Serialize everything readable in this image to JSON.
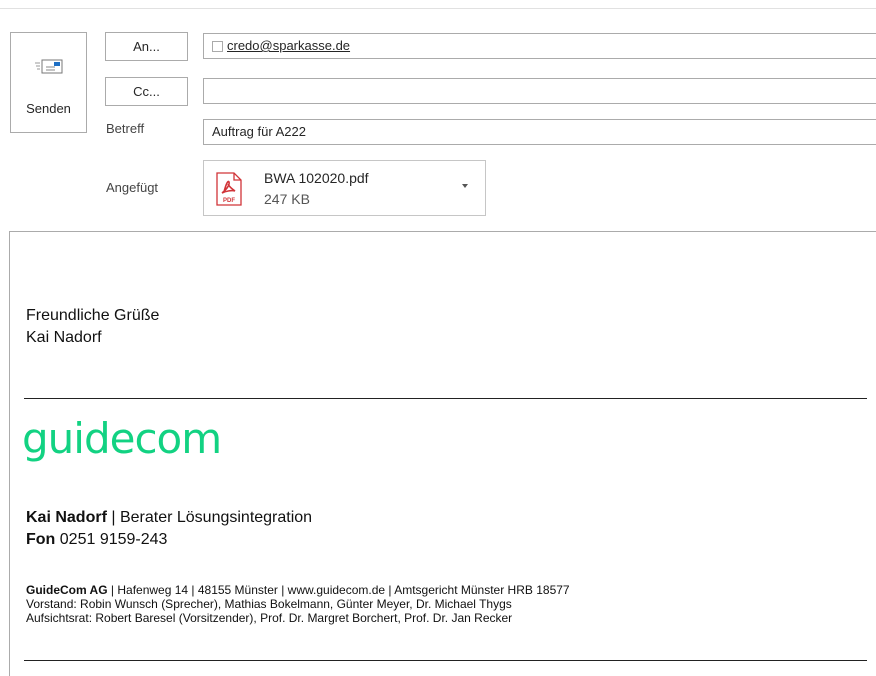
{
  "compose": {
    "send_label": "Senden",
    "to_button": "An...",
    "cc_button": "Cc...",
    "subject_label": "Betreff",
    "attached_label": "Angefügt",
    "to_recipient": "credo@sparkasse.de",
    "cc_value": "",
    "subject_value": "Auftrag für A222"
  },
  "attachment": {
    "name": "BWA 102020.pdf",
    "size": "247 KB",
    "icon": "pdf-icon",
    "icon_text": "PDF"
  },
  "body": {
    "greeting": "Freundliche Grüße",
    "name": "Kai Nadorf"
  },
  "signature": {
    "logo": "guidecom",
    "logo_color": "#12d282",
    "person_name": "Kai Nadorf",
    "person_role": " | Berater Lösungsintegration",
    "phone_label": "Fon",
    "phone": " 0251 9159-243",
    "company_name": "GuideCom AG",
    "company_details": " | Hafenweg 14 | 48155 Münster | www.guidecom.de | Amtsgericht Münster HRB 18577",
    "board": "Vorstand: Robin Wunsch (Sprecher), Mathias Bokelmann, Günter Meyer, Dr. Michael Thygs",
    "supervisory": "Aufsichtsrat: Robert Baresel (Vorsitzender), Prof. Dr. Margret Borchert, Prof. Dr. Jan Recker"
  }
}
